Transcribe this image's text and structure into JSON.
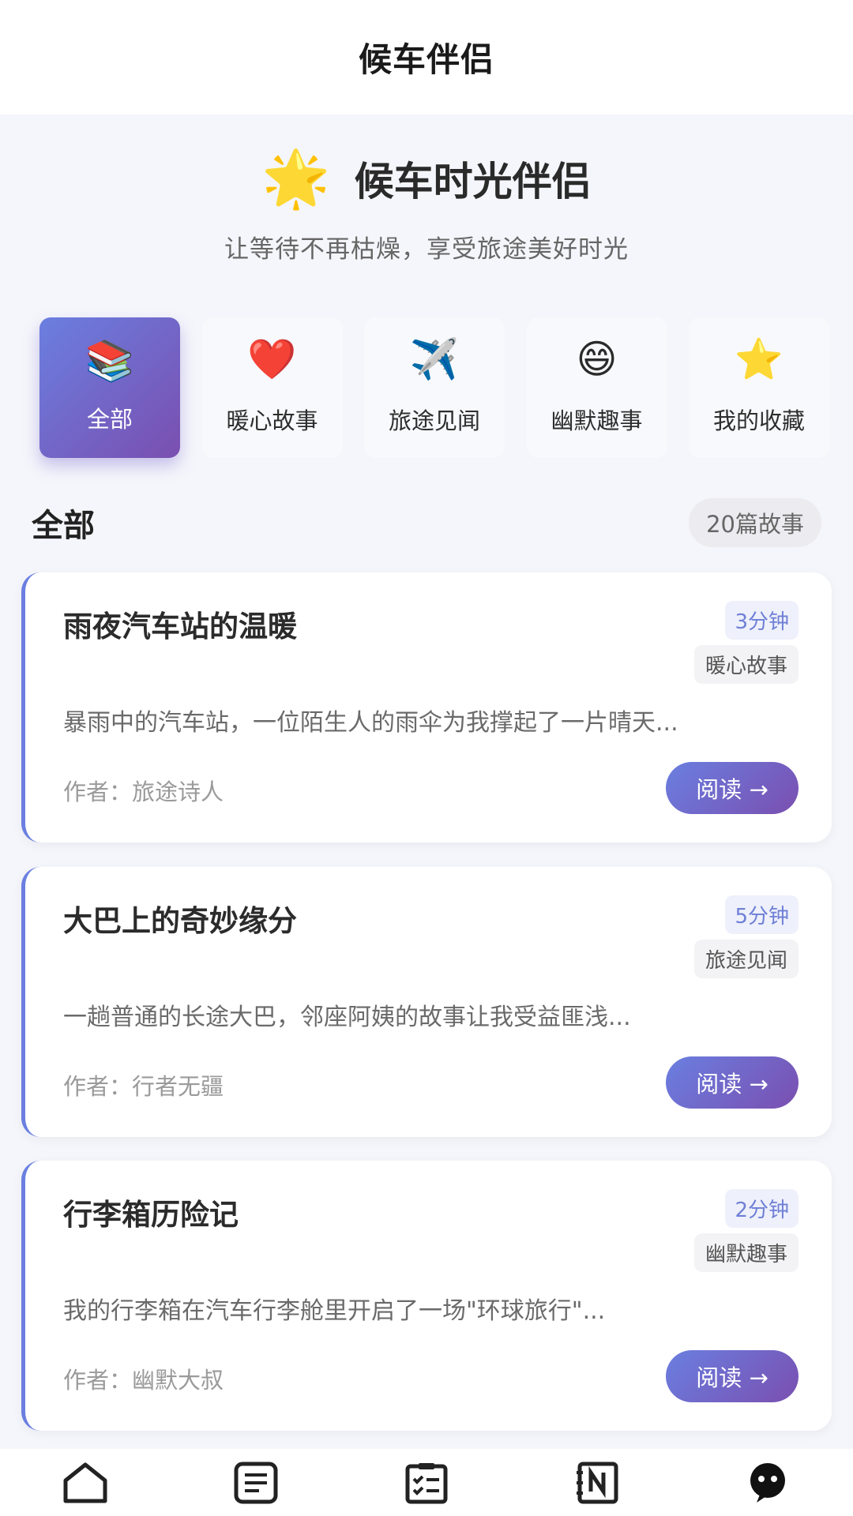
{
  "nav": {
    "title": "候车伴侣"
  },
  "hero": {
    "icon": "sparkle-star-icon",
    "emoji": "🌟",
    "title": "候车时光伴侣",
    "subtitle": "让等待不再枯燥，享受旅途美好时光"
  },
  "categories": [
    {
      "emoji": "📚",
      "icon": "books-icon",
      "label": "全部",
      "selected": true
    },
    {
      "emoji": "❤️",
      "icon": "heart-icon",
      "label": "暖心故事",
      "selected": false
    },
    {
      "emoji": "✈️",
      "icon": "airplane-icon",
      "label": "旅途见闻",
      "selected": false
    },
    {
      "emoji": "😄",
      "icon": "smile-icon",
      "label": "幽默趣事",
      "selected": false
    },
    {
      "emoji": "⭐",
      "icon": "star-icon",
      "label": "我的收藏",
      "selected": false
    }
  ],
  "section": {
    "title": "全部",
    "count": "20篇故事"
  },
  "stories": [
    {
      "title": "雨夜汽车站的温暖",
      "time": "3分钟",
      "category": "暖心故事",
      "excerpt": "暴雨中的汽车站，一位陌生人的雨伞为我撑起了一片晴天...",
      "author": "作者：旅途诗人",
      "read_label": "阅读 →"
    },
    {
      "title": "大巴上的奇妙缘分",
      "time": "5分钟",
      "category": "旅途见闻",
      "excerpt": "一趟普通的长途大巴，邻座阿姨的故事让我受益匪浅...",
      "author": "作者：行者无疆",
      "read_label": "阅读 →"
    },
    {
      "title": "行李箱历险记",
      "time": "2分钟",
      "category": "幽默趣事",
      "excerpt": "我的行李箱在汽车行李舱里开启了一场\"环球旅行\"...",
      "author": "作者：幽默大叔",
      "read_label": "阅读 →"
    }
  ],
  "tabbar": [
    {
      "icon": "home-icon"
    },
    {
      "icon": "document-list-icon"
    },
    {
      "icon": "checklist-icon"
    },
    {
      "icon": "notebook-icon"
    },
    {
      "icon": "chat-bot-icon"
    }
  ],
  "colors": {
    "accent_start": "#6a7fe0",
    "accent_end": "#7a4fb0",
    "time_badge_text": "#6e7fd6"
  }
}
